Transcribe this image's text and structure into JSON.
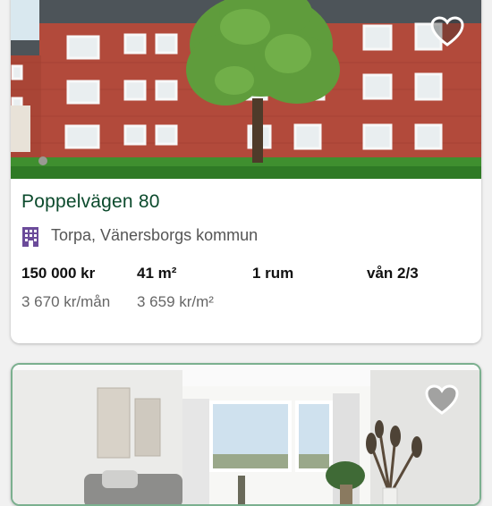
{
  "listings": [
    {
      "title": "Poppelvägen 80",
      "location": "Torpa, Vänersborgs kommun",
      "location_icon": "building-icon",
      "price": "150 000 kr",
      "area": "41 m²",
      "rooms": "1 rum",
      "floor": "vån 2/3",
      "monthly_fee": "3 670 kr/mån",
      "price_per_sqm": "3 659 kr/m²",
      "favorite_icon": "heart-icon",
      "photo": "brick-apartment-building-with-tree"
    },
    {
      "favorite_icon": "heart-icon",
      "photo": "bright-living-room-interior"
    }
  ],
  "colors": {
    "title": "#0b4a2c",
    "location_icon": "#6b4b9a",
    "accent_border": "#7bb08f"
  }
}
